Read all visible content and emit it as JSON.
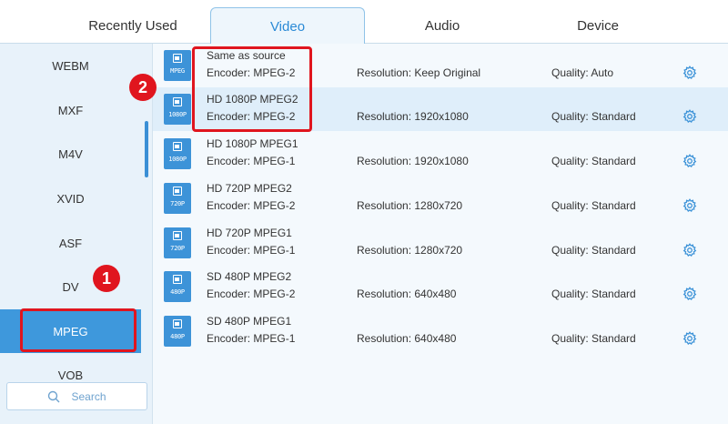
{
  "tabs": [
    {
      "label": "Recently Used",
      "active": false
    },
    {
      "label": "Video",
      "active": true
    },
    {
      "label": "Audio",
      "active": false
    },
    {
      "label": "Device",
      "active": false
    }
  ],
  "sidebar": {
    "items": [
      {
        "label": "WEBM",
        "selected": false
      },
      {
        "label": "MXF",
        "selected": false
      },
      {
        "label": "M4V",
        "selected": false
      },
      {
        "label": "XVID",
        "selected": false
      },
      {
        "label": "ASF",
        "selected": false
      },
      {
        "label": "DV",
        "selected": false
      },
      {
        "label": "MPEG",
        "selected": true
      },
      {
        "label": "VOB",
        "selected": false
      }
    ],
    "search_placeholder": "Search"
  },
  "presets": [
    {
      "icon_label": "MPEG",
      "name": "Same as source",
      "encoder": "Encoder: MPEG-2",
      "resolution": "Resolution: Keep Original",
      "quality": "Quality: Auto",
      "highlighted": false
    },
    {
      "icon_label": "1080P",
      "name": "HD 1080P MPEG2",
      "encoder": "Encoder: MPEG-2",
      "resolution": "Resolution: 1920x1080",
      "quality": "Quality: Standard",
      "highlighted": true
    },
    {
      "icon_label": "1080P",
      "name": "HD 1080P MPEG1",
      "encoder": "Encoder: MPEG-1",
      "resolution": "Resolution: 1920x1080",
      "quality": "Quality: Standard",
      "highlighted": false
    },
    {
      "icon_label": "720P",
      "name": "HD 720P MPEG2",
      "encoder": "Encoder: MPEG-2",
      "resolution": "Resolution: 1280x720",
      "quality": "Quality: Standard",
      "highlighted": false
    },
    {
      "icon_label": "720P",
      "name": "HD 720P MPEG1",
      "encoder": "Encoder: MPEG-1",
      "resolution": "Resolution: 1280x720",
      "quality": "Quality: Standard",
      "highlighted": false
    },
    {
      "icon_label": "480P",
      "name": "SD 480P MPEG2",
      "encoder": "Encoder: MPEG-2",
      "resolution": "Resolution: 640x480",
      "quality": "Quality: Standard",
      "highlighted": false
    },
    {
      "icon_label": "480P",
      "name": "SD 480P MPEG1",
      "encoder": "Encoder: MPEG-1",
      "resolution": "Resolution: 640x480",
      "quality": "Quality: Standard",
      "highlighted": false
    }
  ],
  "annotations": {
    "badge_1": "1",
    "badge_2": "2"
  },
  "colors": {
    "accent": "#3e98dc",
    "annotation": "#e0151e",
    "sidebar_bg": "#e8f2fa",
    "row_highlight": "#dfeefa"
  },
  "icons": {
    "format": "film-icon",
    "settings": "gear-icon",
    "search": "search-icon"
  }
}
